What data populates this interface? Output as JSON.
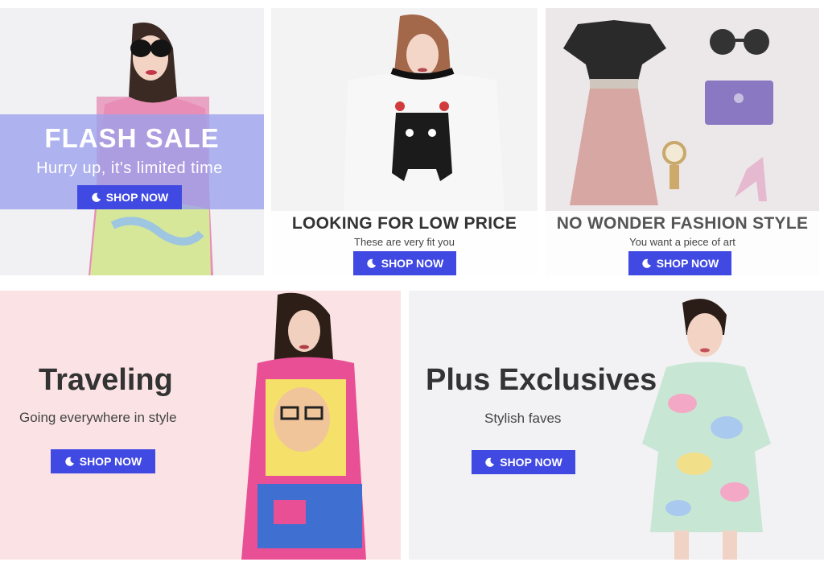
{
  "colors": {
    "accent": "#4049e2",
    "banner_overlay": "#9ba0ec"
  },
  "panels": {
    "flash_sale": {
      "title": "FLASH SALE",
      "subtitle": "Hurry up, it's limited time",
      "button": "SHOP NOW"
    },
    "low_price": {
      "title": "LOOKING FOR LOW PRICE",
      "subtitle": "These are very fit you",
      "button": "SHOP NOW"
    },
    "fashion_style": {
      "title": "NO WONDER FASHION STYLE",
      "subtitle": "You want a piece of art",
      "button": "SHOP NOW"
    },
    "traveling": {
      "title": "Traveling",
      "subtitle": "Going everywhere in style",
      "button": "SHOP NOW"
    },
    "plus": {
      "title": "Plus Exclusives",
      "subtitle": "Stylish faves",
      "button": "SHOP NOW"
    }
  },
  "icons": {
    "button_icon": "crescent-moon-icon"
  }
}
